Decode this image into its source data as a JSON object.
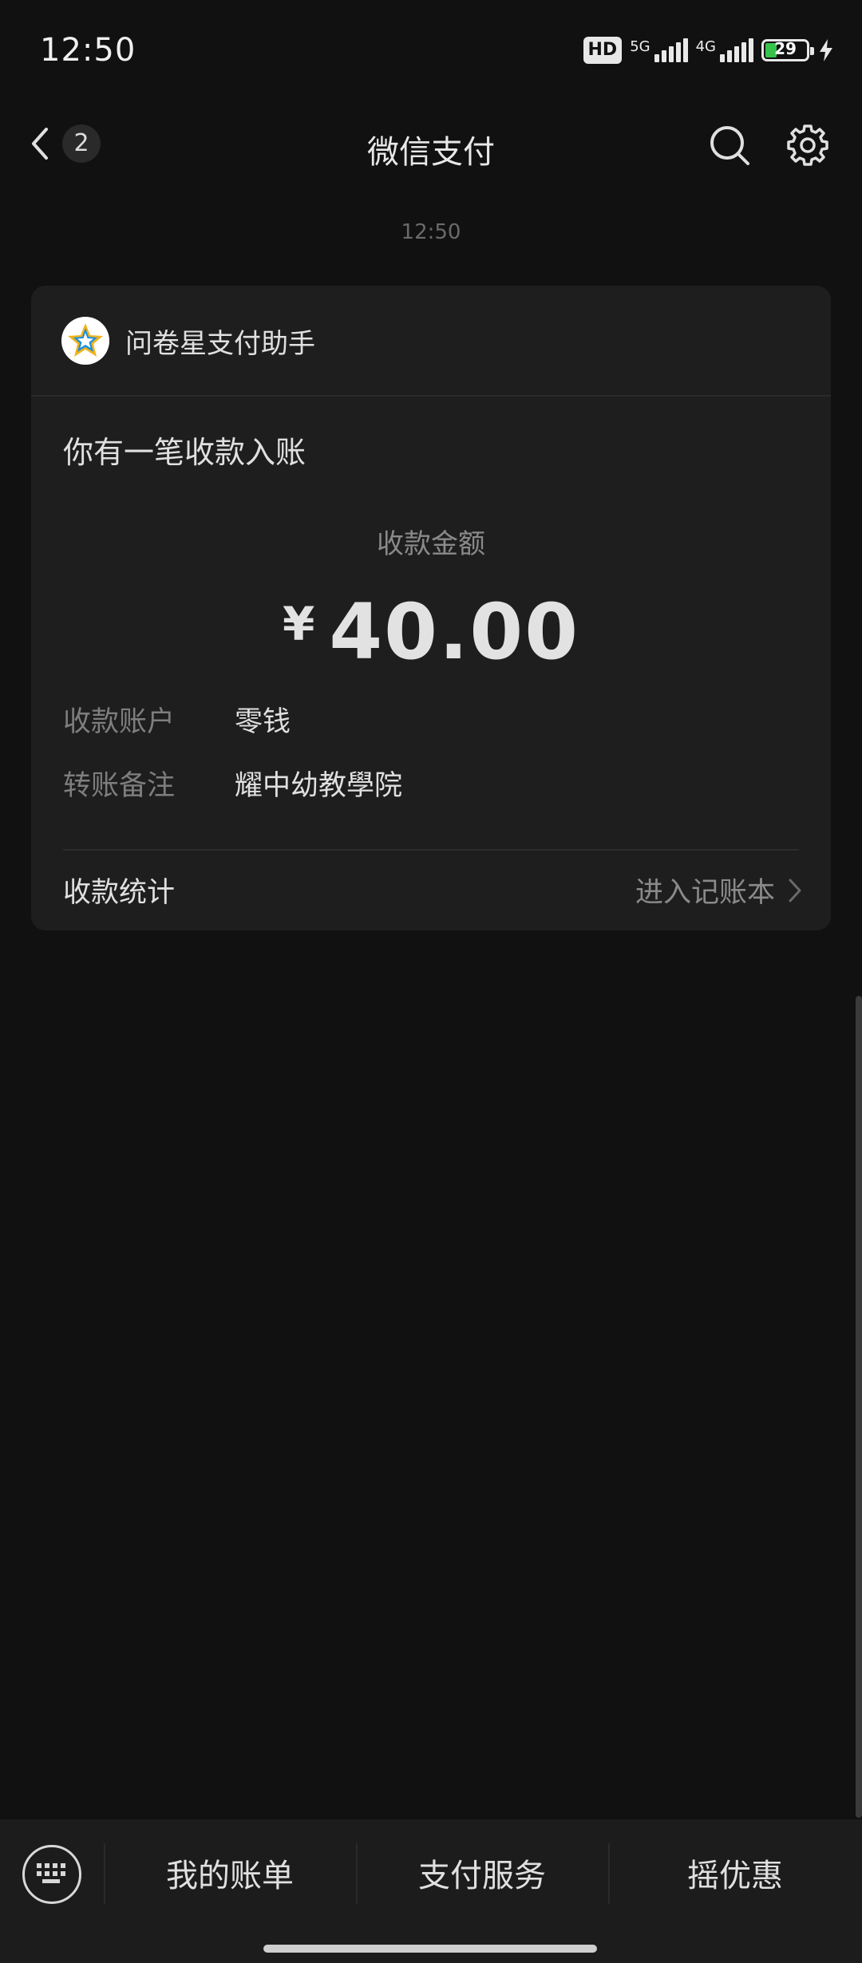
{
  "status": {
    "time": "12:50",
    "hd": "HD",
    "net1": "5G",
    "net2": "4G",
    "battery": "29"
  },
  "nav": {
    "unread_count": "2",
    "title": "微信支付"
  },
  "chat": {
    "timestamp": "12:50"
  },
  "card": {
    "sender": "问卷星支付助手",
    "headline": "你有一笔收款入账",
    "amount_label": "收款金额",
    "currency": "¥",
    "amount": "40.00",
    "account_key": "收款账户",
    "account_val": "零钱",
    "note_key": "转账备注",
    "note_val": "耀中幼教學院",
    "stats_label": "收款统计",
    "ledger_link": "进入记账本"
  },
  "bottom": {
    "menu1": "我的账单",
    "menu2": "支付服务",
    "menu3": "摇优惠"
  },
  "colors": {
    "background": "#111111",
    "card": "#1e1e1e",
    "battery_green": "#37c24a"
  }
}
